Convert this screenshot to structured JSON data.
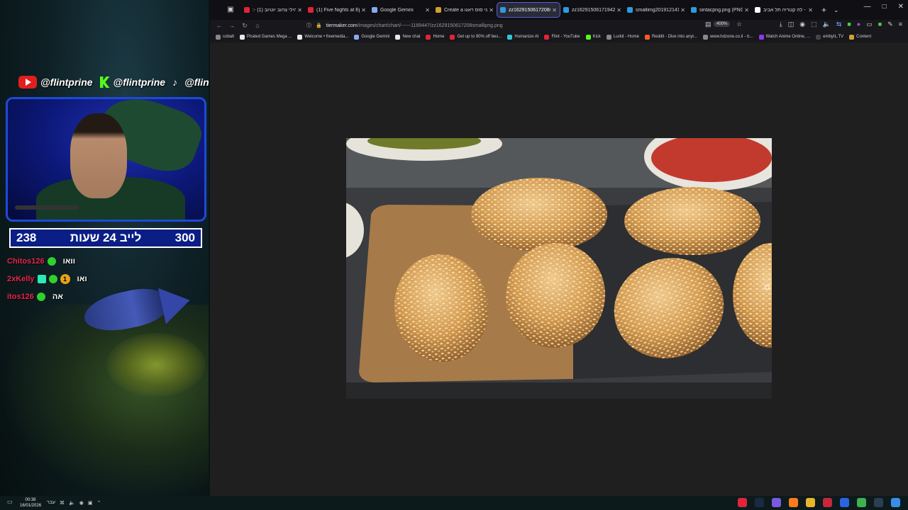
{
  "overlay": {
    "socials": [
      {
        "icon": "youtube-icon",
        "handle": "@flintprine"
      },
      {
        "icon": "kick-icon",
        "handle": "@flintprine"
      },
      {
        "icon": "tiktok-icon",
        "handle": "@flintprine"
      }
    ],
    "counter": {
      "left": "238",
      "title": "לייב 24 שעות",
      "right": "300"
    },
    "chat": [
      {
        "user": "Chitos126",
        "message": "וואו"
      },
      {
        "user": "2xKelly",
        "badge_number": "1",
        "message": "ואו"
      },
      {
        "user": "itos126",
        "message": "אה"
      }
    ]
  },
  "browser": {
    "tabs": [
      {
        "title": ":- הילי צהוב יוטיוב (1)",
        "color": "#e0243a"
      },
      {
        "title": "(1) Five Nights at Epstein",
        "color": "#e0243a"
      },
      {
        "title": "Google Gemini",
        "color": "#8aa8f0"
      },
      {
        "title": "Create a אני סוס ראגו",
        "color": "#d0a030"
      },
      {
        "title": "zz1629150617208smallipng",
        "color": "#2d9cdb",
        "active": true
      },
      {
        "title": "zz16291506171942529-46",
        "color": "#2d9cdb"
      },
      {
        "title": "smallimg20191214120806",
        "color": "#2d9cdb"
      },
      {
        "title": "sintacpng.png (PNG Image",
        "color": "#2d9cdb"
      },
      {
        "title": "לה קטריה תל אביב -",
        "color": "#ffffff"
      }
    ],
    "url": {
      "domain": "tiermaker.com",
      "path": "/images/chart/chart/------1189447/zz1629150617208smallipng.png"
    },
    "zoom": "400%",
    "bookmarks": [
      {
        "label": "cobalt",
        "color": "#888"
      },
      {
        "label": "Pirated Games Mega ...",
        "color": "#e8e8e8"
      },
      {
        "label": "Welcome • freemedia...",
        "color": "#e8e8e8"
      },
      {
        "label": "Google Gemini",
        "color": "#8aa8f0"
      },
      {
        "label": "New chat",
        "color": "#e8e8e8"
      },
      {
        "label": "Home",
        "color": "#e0243a"
      },
      {
        "label": "Get up to 90% off bes...",
        "color": "#e0243a"
      },
      {
        "label": "Humanize AI",
        "color": "#2dc7d8"
      },
      {
        "label": "Flint - YouTube",
        "color": "#e0243a"
      },
      {
        "label": "Kick",
        "color": "#53fc18"
      },
      {
        "label": "Lurkit - Home",
        "color": "#888"
      },
      {
        "label": "Reddit - Dive into anyt...",
        "color": "#ff5a1f"
      },
      {
        "label": "www.hdzone.co.il - ס...",
        "color": "#888"
      },
      {
        "label": "Watch Anime Online, ...",
        "color": "#8a3af0"
      },
      {
        "label": "embyIL.TV",
        "color": "#444"
      },
      {
        "label": "Content",
        "color": "#d0a030"
      }
    ]
  },
  "taskbar": {
    "time": "00:38",
    "date": "16/01/2026",
    "lang": "עבר"
  }
}
